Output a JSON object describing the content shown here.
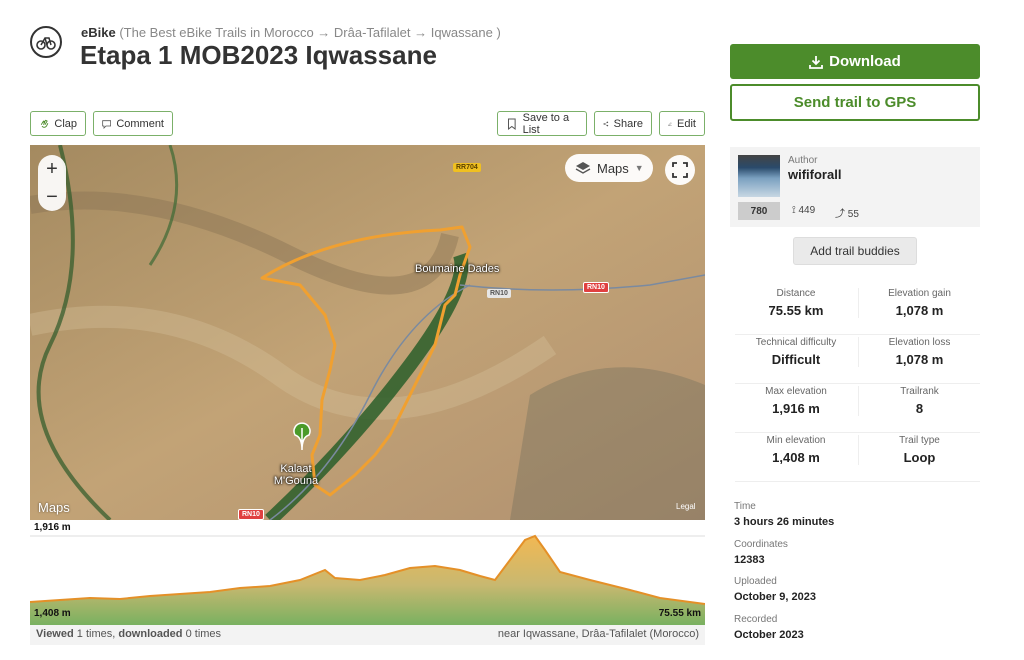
{
  "header": {
    "category": "eBike",
    "breadcrumb": "(The Best eBike Trails in Morocco → Drâa-Tafilalet → Iqwassane )",
    "title": "Etapa 1 MOB2023 Iqwassane"
  },
  "actions": {
    "clap": "Clap",
    "comment": "Comment",
    "save": "Save to a List",
    "share": "Share",
    "edit": "Edit"
  },
  "map": {
    "layers_label": "Maps",
    "attribution": "Maps",
    "legal": "Legal",
    "places": [
      "Boumaine Dades",
      "Kalaat M'Gouna"
    ],
    "roads": [
      "RR704",
      "RN10",
      "RN10",
      "RN10"
    ],
    "zoom_in": "+",
    "zoom_out": "−"
  },
  "elevation": {
    "max_label": "1,916 m",
    "min_label": "1,408 m",
    "distance_label": "75.55 km"
  },
  "footer": {
    "viewed_label": "Viewed",
    "viewed_count": "1 times,",
    "downloaded_label": "downloaded",
    "downloaded_count": "0 times",
    "near": "near Iqwassane, Drâa-Tafilalet (Morocco)"
  },
  "sidebar": {
    "download": "Download",
    "send_gps": "Send trail to GPS",
    "author_label": "Author",
    "author_name": "wififorall",
    "rank": "780",
    "stat_a": "449",
    "stat_b": "55",
    "buddies": "Add trail buddies"
  },
  "stats": [
    {
      "label": "Distance",
      "value": "75.55 km"
    },
    {
      "label": "Elevation gain",
      "value": "1,078 m"
    },
    {
      "label": "Technical difficulty",
      "value": "Difficult"
    },
    {
      "label": "Elevation loss",
      "value": "1,078 m"
    },
    {
      "label": "Max elevation",
      "value": "1,916 m"
    },
    {
      "label": "Trailrank",
      "value": "8"
    },
    {
      "label": "Min elevation",
      "value": "1,408 m"
    },
    {
      "label": "Trail type",
      "value": "Loop"
    }
  ],
  "meta": [
    {
      "label": "Time",
      "value": "3 hours 26 minutes"
    },
    {
      "label": "Coordinates",
      "value": "12383"
    },
    {
      "label": "Uploaded",
      "value": "October 9, 2023"
    },
    {
      "label": "Recorded",
      "value": "October 2023"
    }
  ],
  "colors": {
    "accent": "#4c8c2b",
    "track": "#f0a030"
  }
}
